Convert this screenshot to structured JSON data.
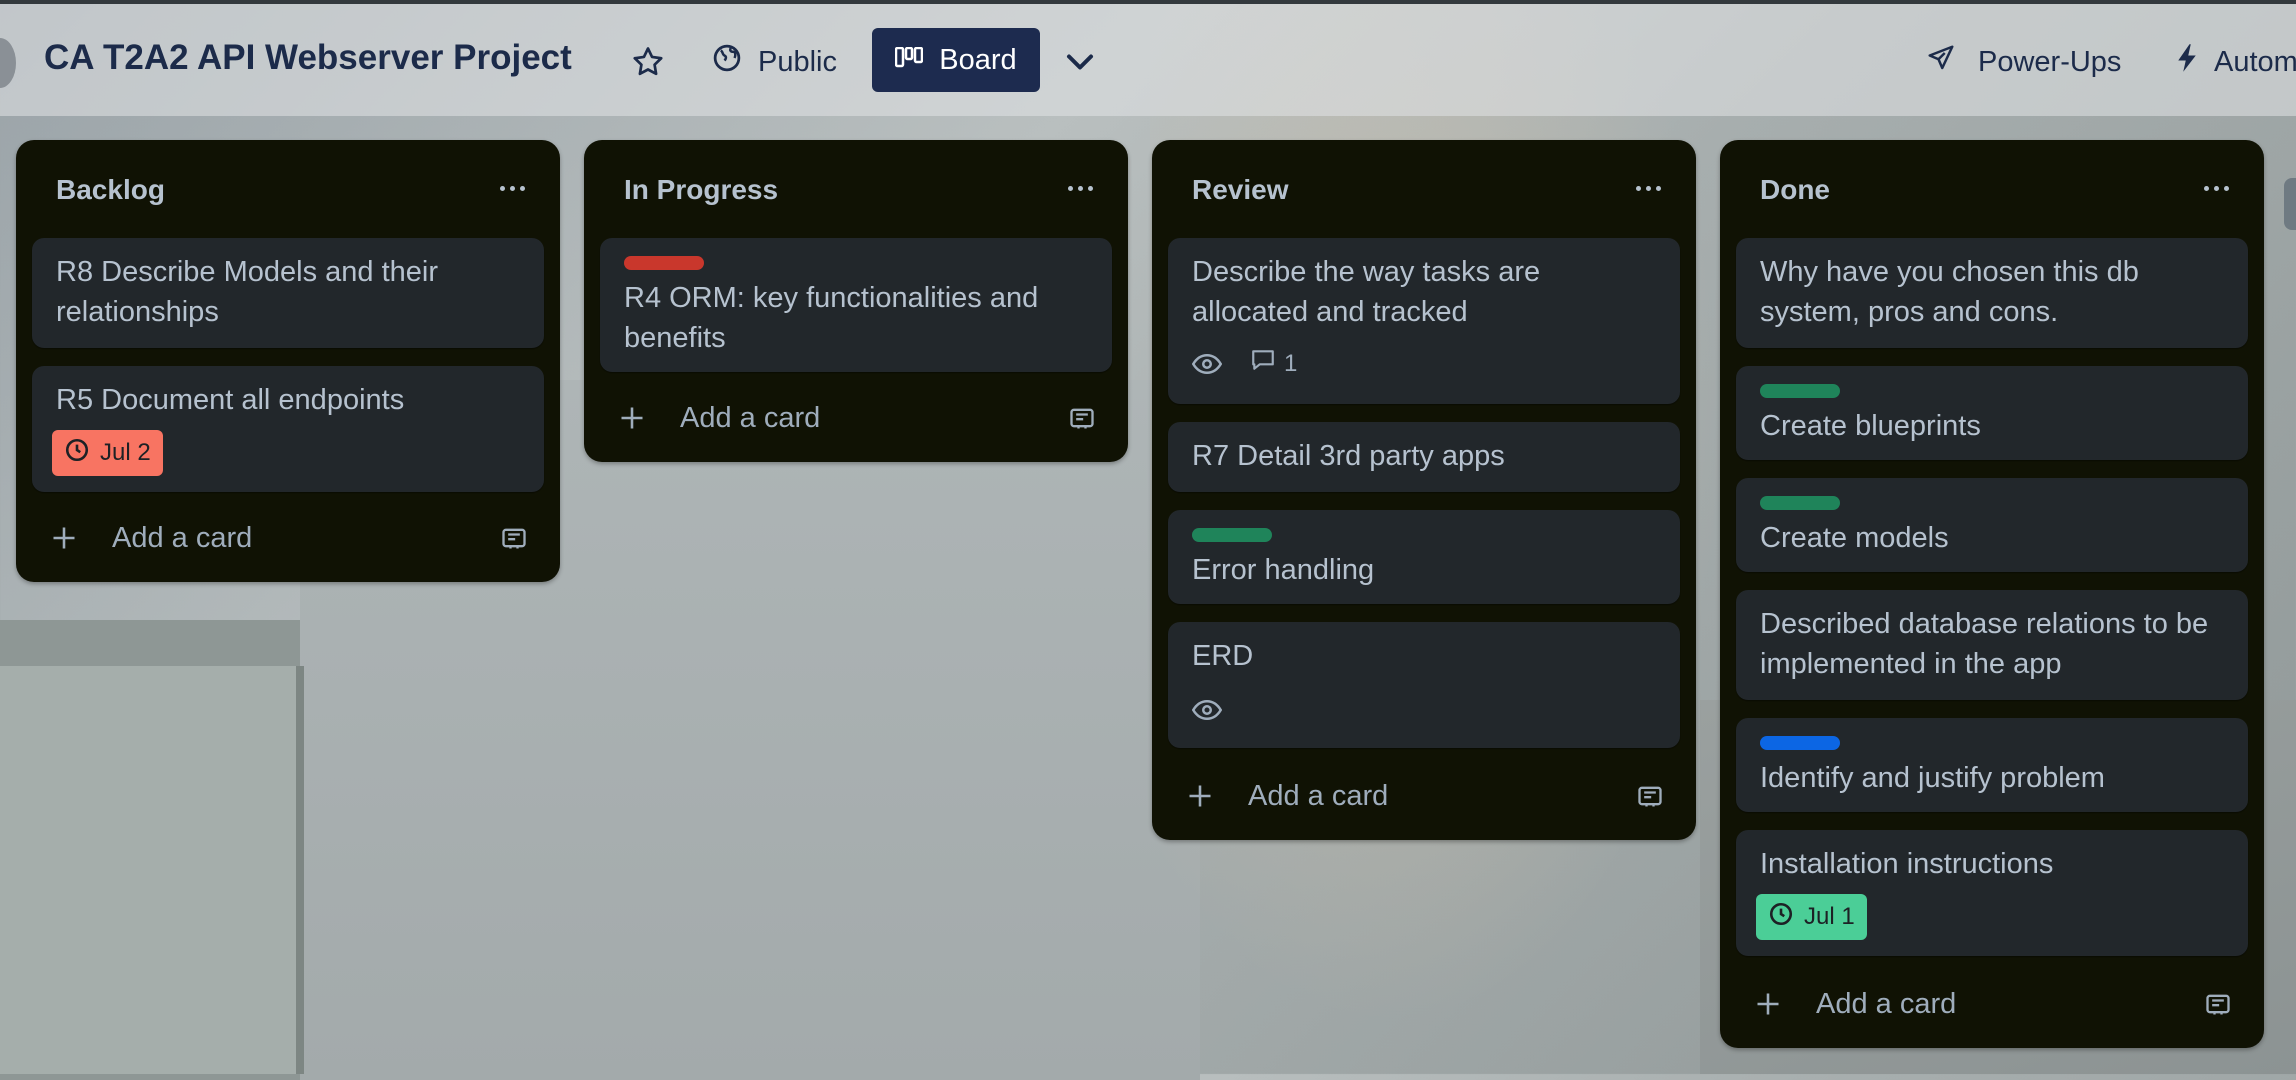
{
  "header": {
    "board_title": "CA T2A2 API Webserver Project",
    "visibility_label": "Public",
    "view_label": "Board",
    "powerups_label": "Power-Ups",
    "automation_label": "Autom"
  },
  "lists": [
    {
      "title": "Backlog",
      "cards": [
        {
          "text": "R8 Describe Models and their relationships"
        },
        {
          "text": "R5 Document all endpoints",
          "due": "Jul 2",
          "due_color": "#f87462"
        }
      ],
      "add_label": "Add a card"
    },
    {
      "title": "In Progress",
      "cards": [
        {
          "text": "R4 ORM: key functionalities and benefits",
          "label_color": "#c9372c"
        }
      ],
      "add_label": "Add a card"
    },
    {
      "title": "Review",
      "cards": [
        {
          "text": "Describe the way tasks are allocated and tracked",
          "watching": true,
          "comments": "1"
        },
        {
          "text": "R7 Detail 3rd party apps"
        },
        {
          "text": "Error handling",
          "label_color": "#1f845a"
        },
        {
          "text": "ERD",
          "watching": true
        }
      ],
      "add_label": "Add a card"
    },
    {
      "title": "Done",
      "cards": [
        {
          "text": "Why have you chosen this db system, pros and cons."
        },
        {
          "text": "Create blueprints",
          "label_color": "#1f845a"
        },
        {
          "text": "Create models",
          "label_color": "#1f845a"
        },
        {
          "text": "Described database relations to be implemented in the app"
        },
        {
          "text": "Identify and justify problem",
          "label_color": "#0c66e4"
        },
        {
          "text": "Installation instructions",
          "due": "Jul 1",
          "due_color": "#4bce97"
        }
      ],
      "add_label": "Add a card"
    }
  ],
  "icons": {
    "star": "star-icon",
    "visibility": "globe-icon",
    "board": "board-icon",
    "chevron": "chevron-down-icon",
    "powerups": "rocket-icon",
    "automation": "lightning-icon",
    "add": "plus-icon",
    "template": "card-template-icon",
    "clock": "clock-icon",
    "eye": "eye-icon",
    "comment": "comment-icon",
    "menu": "more-icon"
  }
}
